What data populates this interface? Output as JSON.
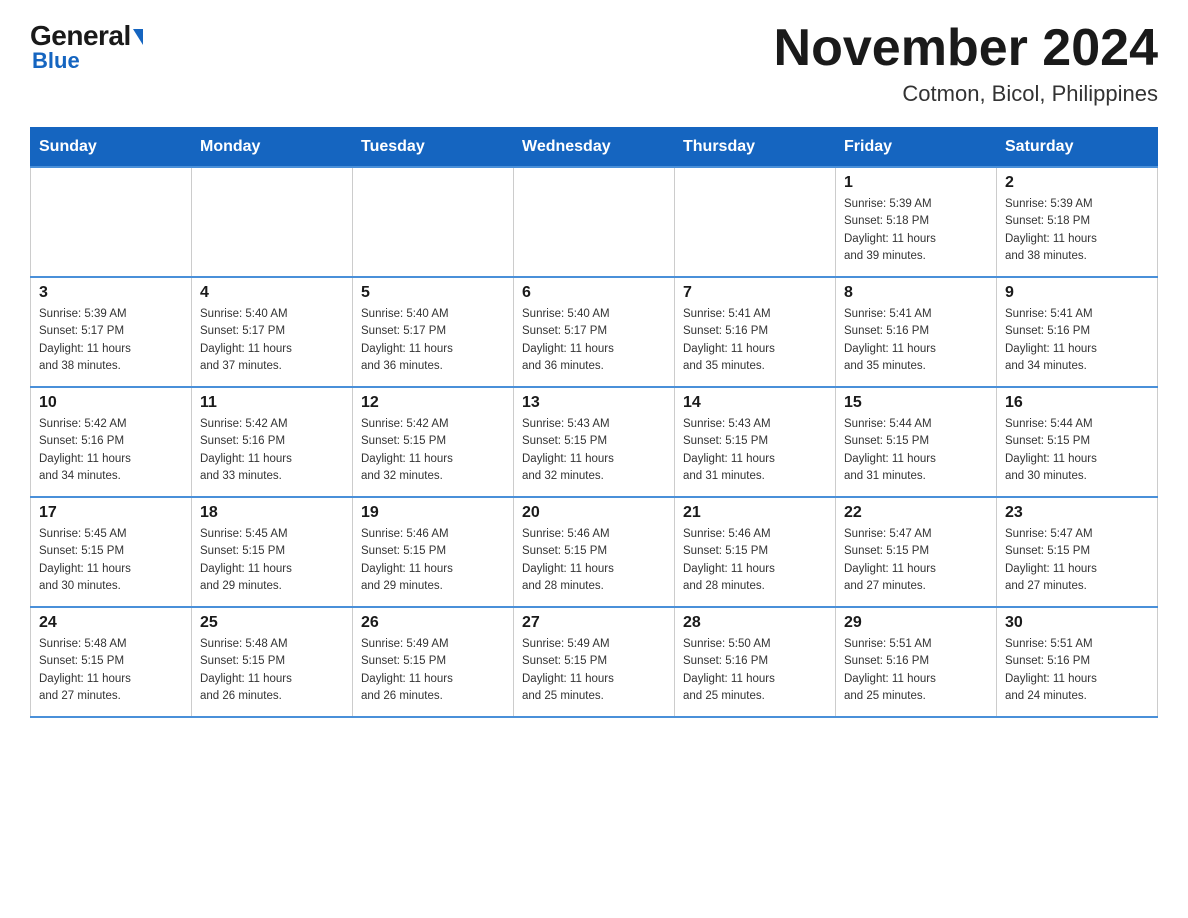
{
  "logo": {
    "name_part1": "General",
    "name_part2": "Blue"
  },
  "title": {
    "month_year": "November 2024",
    "location": "Cotmon, Bicol, Philippines"
  },
  "days_of_week": [
    "Sunday",
    "Monday",
    "Tuesday",
    "Wednesday",
    "Thursday",
    "Friday",
    "Saturday"
  ],
  "weeks": [
    [
      {
        "day": "",
        "info": ""
      },
      {
        "day": "",
        "info": ""
      },
      {
        "day": "",
        "info": ""
      },
      {
        "day": "",
        "info": ""
      },
      {
        "day": "",
        "info": ""
      },
      {
        "day": "1",
        "info": "Sunrise: 5:39 AM\nSunset: 5:18 PM\nDaylight: 11 hours\nand 39 minutes."
      },
      {
        "day": "2",
        "info": "Sunrise: 5:39 AM\nSunset: 5:18 PM\nDaylight: 11 hours\nand 38 minutes."
      }
    ],
    [
      {
        "day": "3",
        "info": "Sunrise: 5:39 AM\nSunset: 5:17 PM\nDaylight: 11 hours\nand 38 minutes."
      },
      {
        "day": "4",
        "info": "Sunrise: 5:40 AM\nSunset: 5:17 PM\nDaylight: 11 hours\nand 37 minutes."
      },
      {
        "day": "5",
        "info": "Sunrise: 5:40 AM\nSunset: 5:17 PM\nDaylight: 11 hours\nand 36 minutes."
      },
      {
        "day": "6",
        "info": "Sunrise: 5:40 AM\nSunset: 5:17 PM\nDaylight: 11 hours\nand 36 minutes."
      },
      {
        "day": "7",
        "info": "Sunrise: 5:41 AM\nSunset: 5:16 PM\nDaylight: 11 hours\nand 35 minutes."
      },
      {
        "day": "8",
        "info": "Sunrise: 5:41 AM\nSunset: 5:16 PM\nDaylight: 11 hours\nand 35 minutes."
      },
      {
        "day": "9",
        "info": "Sunrise: 5:41 AM\nSunset: 5:16 PM\nDaylight: 11 hours\nand 34 minutes."
      }
    ],
    [
      {
        "day": "10",
        "info": "Sunrise: 5:42 AM\nSunset: 5:16 PM\nDaylight: 11 hours\nand 34 minutes."
      },
      {
        "day": "11",
        "info": "Sunrise: 5:42 AM\nSunset: 5:16 PM\nDaylight: 11 hours\nand 33 minutes."
      },
      {
        "day": "12",
        "info": "Sunrise: 5:42 AM\nSunset: 5:15 PM\nDaylight: 11 hours\nand 32 minutes."
      },
      {
        "day": "13",
        "info": "Sunrise: 5:43 AM\nSunset: 5:15 PM\nDaylight: 11 hours\nand 32 minutes."
      },
      {
        "day": "14",
        "info": "Sunrise: 5:43 AM\nSunset: 5:15 PM\nDaylight: 11 hours\nand 31 minutes."
      },
      {
        "day": "15",
        "info": "Sunrise: 5:44 AM\nSunset: 5:15 PM\nDaylight: 11 hours\nand 31 minutes."
      },
      {
        "day": "16",
        "info": "Sunrise: 5:44 AM\nSunset: 5:15 PM\nDaylight: 11 hours\nand 30 minutes."
      }
    ],
    [
      {
        "day": "17",
        "info": "Sunrise: 5:45 AM\nSunset: 5:15 PM\nDaylight: 11 hours\nand 30 minutes."
      },
      {
        "day": "18",
        "info": "Sunrise: 5:45 AM\nSunset: 5:15 PM\nDaylight: 11 hours\nand 29 minutes."
      },
      {
        "day": "19",
        "info": "Sunrise: 5:46 AM\nSunset: 5:15 PM\nDaylight: 11 hours\nand 29 minutes."
      },
      {
        "day": "20",
        "info": "Sunrise: 5:46 AM\nSunset: 5:15 PM\nDaylight: 11 hours\nand 28 minutes."
      },
      {
        "day": "21",
        "info": "Sunrise: 5:46 AM\nSunset: 5:15 PM\nDaylight: 11 hours\nand 28 minutes."
      },
      {
        "day": "22",
        "info": "Sunrise: 5:47 AM\nSunset: 5:15 PM\nDaylight: 11 hours\nand 27 minutes."
      },
      {
        "day": "23",
        "info": "Sunrise: 5:47 AM\nSunset: 5:15 PM\nDaylight: 11 hours\nand 27 minutes."
      }
    ],
    [
      {
        "day": "24",
        "info": "Sunrise: 5:48 AM\nSunset: 5:15 PM\nDaylight: 11 hours\nand 27 minutes."
      },
      {
        "day": "25",
        "info": "Sunrise: 5:48 AM\nSunset: 5:15 PM\nDaylight: 11 hours\nand 26 minutes."
      },
      {
        "day": "26",
        "info": "Sunrise: 5:49 AM\nSunset: 5:15 PM\nDaylight: 11 hours\nand 26 minutes."
      },
      {
        "day": "27",
        "info": "Sunrise: 5:49 AM\nSunset: 5:15 PM\nDaylight: 11 hours\nand 25 minutes."
      },
      {
        "day": "28",
        "info": "Sunrise: 5:50 AM\nSunset: 5:16 PM\nDaylight: 11 hours\nand 25 minutes."
      },
      {
        "day": "29",
        "info": "Sunrise: 5:51 AM\nSunset: 5:16 PM\nDaylight: 11 hours\nand 25 minutes."
      },
      {
        "day": "30",
        "info": "Sunrise: 5:51 AM\nSunset: 5:16 PM\nDaylight: 11 hours\nand 24 minutes."
      }
    ]
  ]
}
